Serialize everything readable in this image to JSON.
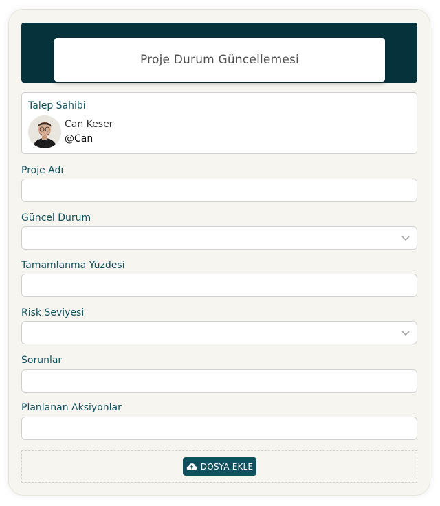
{
  "header": {
    "title": "Proje Durum Güncellemesi"
  },
  "requester": {
    "label": "Talep Sahibi",
    "name": "Can Keser",
    "handle": "@Can"
  },
  "fields": [
    {
      "label": "Proje Adı",
      "type": "text",
      "value": ""
    },
    {
      "label": "Güncel Durum",
      "type": "select",
      "value": ""
    },
    {
      "label": "Tamamlanma Yüzdesi",
      "type": "text",
      "value": ""
    },
    {
      "label": "Risk Seviyesi",
      "type": "select",
      "value": ""
    },
    {
      "label": "Sorunlar",
      "type": "text",
      "value": ""
    },
    {
      "label": "Planlanan Aksiyonlar",
      "type": "text",
      "value": ""
    }
  ],
  "upload": {
    "label": "DOSYA EKLE",
    "icon": "cloud-upload-icon"
  },
  "colors": {
    "header_bg": "#06323b",
    "label_text": "#10515d",
    "button_bg": "#10515d",
    "card_bg": "#f7f5f0"
  }
}
